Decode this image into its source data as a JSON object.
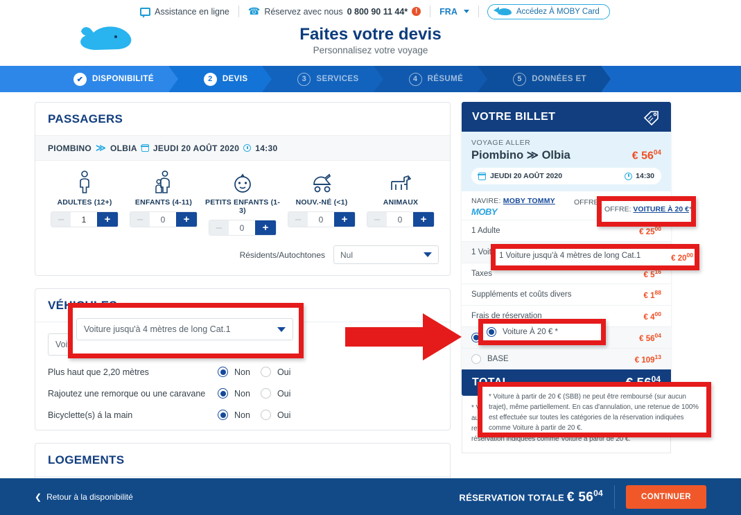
{
  "topbar": {
    "assistance": "Assistance en ligne",
    "phone_prefix": "Réservez avec nous",
    "phone_number": "0 800 90 11 44*",
    "alert_glyph": "!",
    "lang": "FRA",
    "moby_card": "Accédez À MOBY Card"
  },
  "header": {
    "title": "Faites votre devis",
    "subtitle": "Personnalisez votre voyage"
  },
  "stepper": [
    {
      "num": "✔",
      "label": "DISPONIBILITÉ",
      "state": "done"
    },
    {
      "num": "2",
      "label": "DEVIS",
      "state": "current"
    },
    {
      "num": "3",
      "label": "SERVICES",
      "state": "todo"
    },
    {
      "num": "4",
      "label": "RÉSUMÉ",
      "state": "todo"
    },
    {
      "num": "5",
      "label": "DONNÉES ET",
      "state": "todo"
    }
  ],
  "passengers": {
    "title": "PASSAGERS",
    "route": {
      "from": "PIOMBINO",
      "arrow": "≫",
      "to": "OLBIA",
      "date": "JEUDI 20 AOÛT 2020",
      "time": "14:30"
    },
    "categories": [
      {
        "label": "ADULTES (12+)",
        "value": "1",
        "icon": "adult-icon"
      },
      {
        "label": "ENFANTS (4-11)",
        "value": "0",
        "icon": "child-icon"
      },
      {
        "label": "PETITS ENFANTS (1-3)",
        "value": "0",
        "icon": "toddler-icon"
      },
      {
        "label": "NOUV.-NÉ (<1)",
        "value": "0",
        "icon": "stroller-icon"
      },
      {
        "label": "ANIMAUX",
        "value": "0",
        "icon": "pet-icon"
      }
    ],
    "minus": "–",
    "plus": "+",
    "resident_label": "Résidents/Autochtones",
    "resident_value": "Nul"
  },
  "vehicles": {
    "title": "VÉHICULES",
    "selected": "Voiture jusqu'à 4 mètres de long Cat.1",
    "options": [
      {
        "label": "Plus haut que 2,20 mètres",
        "no": "Non",
        "yes": "Oui",
        "selected": "Non"
      },
      {
        "label": "Rajoutez une remorque ou une caravane",
        "no": "Non",
        "yes": "Oui",
        "selected": "Non"
      },
      {
        "label": "Bicyclette(s) á la main",
        "no": "Non",
        "yes": "Oui",
        "selected": "Non"
      }
    ]
  },
  "lodgings": {
    "title": "LOGEMENTS"
  },
  "ticket": {
    "title": "VOTRE BILLET",
    "voyage_label": "VOYAGE ALLER",
    "route": "Piombino ≫ Olbia",
    "price": "€ 56",
    "price_cents": "04",
    "date": "JEUDI 20 AOÛT 2020",
    "time": "14:30",
    "navire_label": "NAVIRE:",
    "navire_name": "MOBY TOMMY",
    "navire_brand": "MOBY",
    "offre_label": "OFFRE:",
    "offre_value": "VOITURE À 20 €",
    "offre_star": "*",
    "lines": [
      {
        "label": "1 Adulte",
        "amount": "€ 25",
        "cents": "00"
      },
      {
        "label": "1 Voiture jusqu'à 4 mètres de long Cat.1",
        "amount": "€ 20",
        "cents": "00"
      },
      {
        "label": "Taxes",
        "amount": "€ 5",
        "cents": "16"
      },
      {
        "label": "Suppléments et coûts divers",
        "amount": "€ 1",
        "cents": "88"
      },
      {
        "label": "Frais de réservation",
        "amount": "€ 4",
        "cents": "00"
      }
    ],
    "offers": [
      {
        "label": "Voiture À 20 € *",
        "amount": "€ 56",
        "cents": "04",
        "selected": true
      },
      {
        "label": "BASE",
        "amount": "€ 109",
        "cents": "13",
        "selected": false
      }
    ],
    "total_label": "TOTAL",
    "total_amount": "€ 56",
    "total_cents": "04",
    "note": "* Voiture à partir de 20 € (SBB) ne peut être remboursé (sur aucun trajet), même partiellement. En cas d'annulation, une retenue de 100% est effectuée sur toutes les catégories de la réservation indiquées comme Voiture à partir de 20 €."
  },
  "footer": {
    "back": "Retour à la disponibilité",
    "total_label": "RÉSERVATION TOTALE",
    "total_amount": "€ 56",
    "total_cents": "04",
    "continue": "CONTINUER"
  },
  "colors": {
    "brand_blue": "#123e7f",
    "accent_blue": "#2aace2",
    "price_orange": "#f04e23",
    "cta_orange": "#f0582a",
    "annotation_red": "#e51b1b"
  }
}
